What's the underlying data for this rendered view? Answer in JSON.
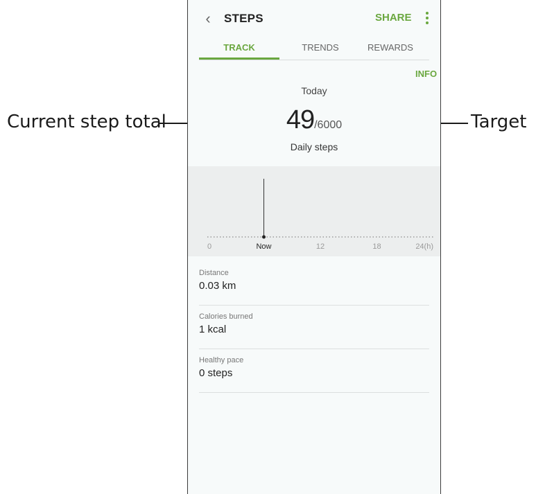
{
  "callouts": {
    "current": "Current step total",
    "target": "Target"
  },
  "header": {
    "title": "STEPS",
    "share": "SHARE",
    "back_icon": "chevron-left-icon",
    "more_icon": "more-vert-icon"
  },
  "tabs": [
    {
      "label": "TRACK",
      "active": true
    },
    {
      "label": "TRENDS",
      "active": false
    },
    {
      "label": "REWARDS",
      "active": false
    }
  ],
  "summary": {
    "info": "INFO",
    "period": "Today",
    "steps": "49",
    "target": "/6000",
    "caption": "Daily steps"
  },
  "chart_data": {
    "type": "bar",
    "x_ticks": [
      "0",
      "Now",
      "12",
      "18",
      "24(h)"
    ],
    "x_tick_hours": [
      0,
      6,
      12,
      18,
      24
    ],
    "now_hour": 6,
    "values": [
      {
        "hour": 6,
        "steps": 49
      }
    ],
    "xlim": [
      0,
      24
    ]
  },
  "stats": [
    {
      "label": "Distance",
      "value": "0.03 km"
    },
    {
      "label": "Calories burned",
      "value": "1 kcal"
    },
    {
      "label": "Healthy pace",
      "value": "0 steps"
    }
  ],
  "colors": {
    "accent": "#6aa73f",
    "background": "#f7fafa",
    "chart_background": "#eceeee"
  }
}
